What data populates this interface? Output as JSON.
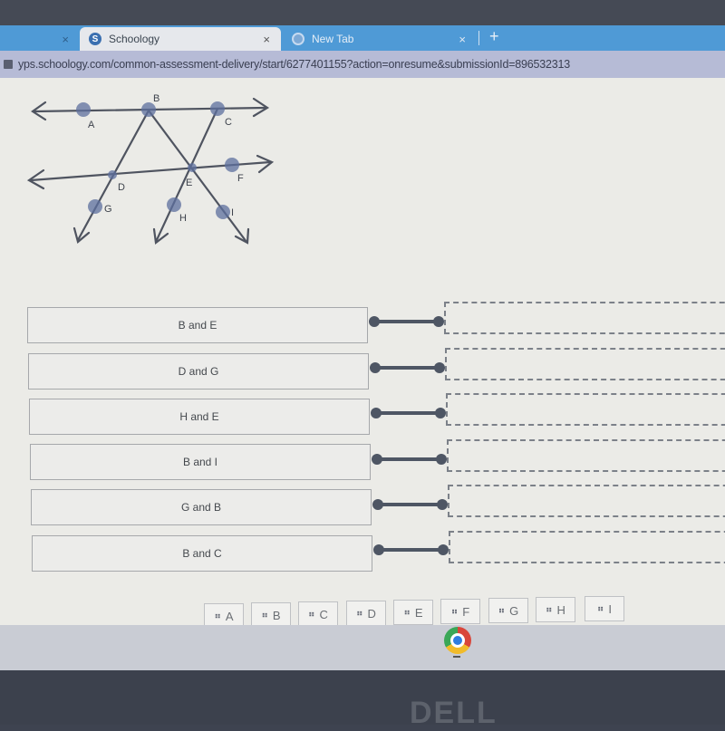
{
  "browser": {
    "tabs": [
      {
        "label": "",
        "close": "×",
        "active": false
      },
      {
        "label": "Schoology",
        "favicon": "S",
        "close": "×",
        "active": true
      },
      {
        "label": "New Tab",
        "close": "×",
        "active": false
      }
    ],
    "new_tab": "+",
    "url": "yps.schoology.com/common-assessment-delivery/start/6277401155?action=onresume&submissionId=896532313"
  },
  "figure": {
    "points": [
      "A",
      "B",
      "C",
      "D",
      "E",
      "F",
      "G",
      "H",
      "I"
    ]
  },
  "matching": {
    "pairs": [
      {
        "label": "B and E"
      },
      {
        "label": "D and G"
      },
      {
        "label": "H and E"
      },
      {
        "label": "B and I"
      },
      {
        "label": "G and B"
      },
      {
        "label": "B and C"
      }
    ]
  },
  "answer_chips": [
    {
      "grip": "⠶",
      "label": "A"
    },
    {
      "grip": "⠶",
      "label": "B"
    },
    {
      "grip": "⠶",
      "label": "C"
    },
    {
      "grip": "⠶",
      "label": "D"
    },
    {
      "grip": "⠶",
      "label": "E"
    },
    {
      "grip": "⠶",
      "label": "F"
    },
    {
      "grip": "⠶",
      "label": "G"
    },
    {
      "grip": "⠶",
      "label": "H"
    },
    {
      "grip": "⠶",
      "label": "I"
    }
  ],
  "device": {
    "brand": "DELL"
  }
}
